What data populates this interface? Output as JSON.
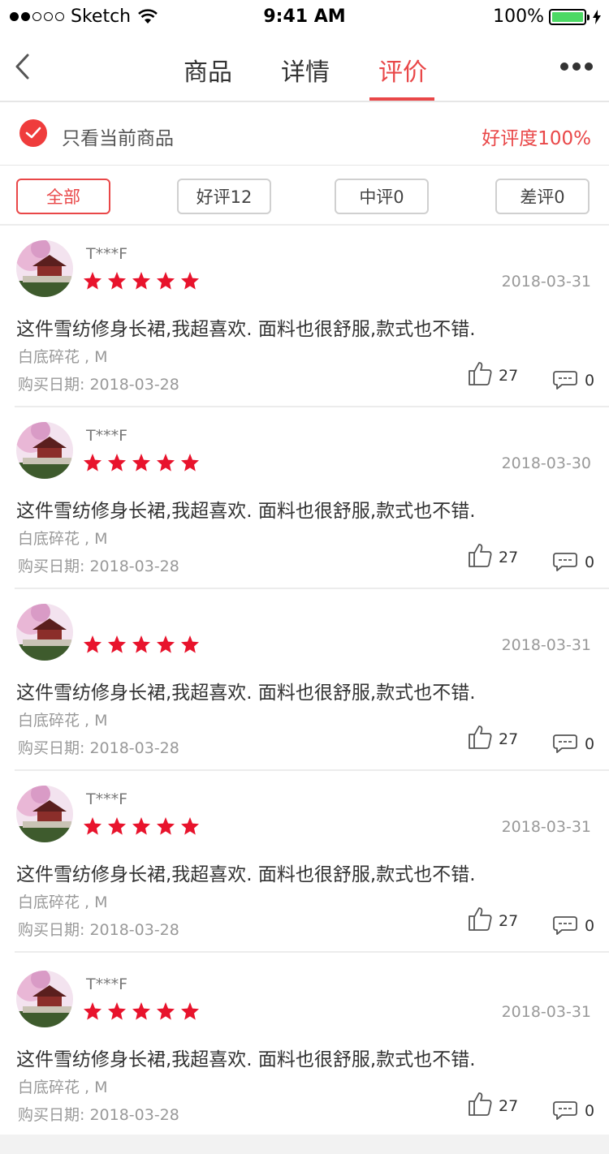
{
  "status_bar": {
    "carrier": "Sketch",
    "time": "9:41 AM",
    "battery": "100%"
  },
  "nav": {
    "tabs": [
      {
        "label": "商品",
        "active": false
      },
      {
        "label": "详情",
        "active": false
      },
      {
        "label": "评价",
        "active": true
      }
    ]
  },
  "filter": {
    "only_current_label": "只看当前商品",
    "only_current_checked": true,
    "good_rate": "好评度100%"
  },
  "chips": [
    {
      "label": "全部",
      "active": true
    },
    {
      "label": "好评12",
      "active": false
    },
    {
      "label": "中评0",
      "active": false
    },
    {
      "label": "差评0",
      "active": false
    }
  ],
  "colors": {
    "accent": "#e94748",
    "star": "#e8132c"
  },
  "reviews": [
    {
      "user": "T***F",
      "rating": 5,
      "date": "2018-03-31",
      "text": "这件雪纺修身长裙,我超喜欢. 面料也很舒服,款式也不错.",
      "spec": "白底碎花 , M",
      "purchase": "购买日期: 2018-03-28",
      "likes": "27",
      "comments": "0"
    },
    {
      "user": "T***F",
      "rating": 5,
      "date": "2018-03-30",
      "text": "这件雪纺修身长裙,我超喜欢. 面料也很舒服,款式也不错.",
      "spec": "白底碎花 , M",
      "purchase": "购买日期: 2018-03-28",
      "likes": "27",
      "comments": "0"
    },
    {
      "user": "",
      "rating": 5,
      "date": "2018-03-31",
      "text": "这件雪纺修身长裙,我超喜欢. 面料也很舒服,款式也不错.",
      "spec": "白底碎花 , M",
      "purchase": "购买日期: 2018-03-28",
      "likes": "27",
      "comments": "0"
    },
    {
      "user": "T***F",
      "rating": 5,
      "date": "2018-03-31",
      "text": "这件雪纺修身长裙,我超喜欢. 面料也很舒服,款式也不错.",
      "spec": "白底碎花 , M",
      "purchase": "购买日期: 2018-03-28",
      "likes": "27",
      "comments": "0"
    },
    {
      "user": "T***F",
      "rating": 5,
      "date": "2018-03-31",
      "text": "这件雪纺修身长裙,我超喜欢. 面料也很舒服,款式也不错.",
      "spec": "白底碎花 , M",
      "purchase": "购买日期: 2018-03-28",
      "likes": "27",
      "comments": "0"
    }
  ]
}
